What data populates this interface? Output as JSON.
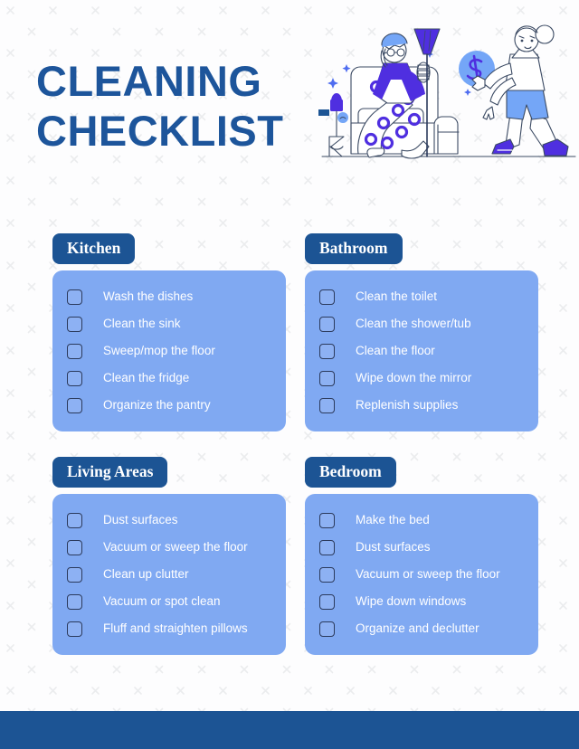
{
  "page": {
    "title_lines": [
      "CLEANING",
      "CHECKLIST"
    ],
    "title_color": "#1d559b",
    "background_color": "#fdfdfe",
    "pattern_icon": "x-mark-pattern",
    "pattern_color": "#ebecee"
  },
  "illustration": {
    "name": "cleaning-people-illustration",
    "line_color": "#3b4a63",
    "accent_purple": "#4f2fe0",
    "accent_blue": "#74a6f7",
    "elements": [
      "person-with-broom-on-armchair",
      "person-reaching-for-money-bubble",
      "armchair",
      "broom-in-stand",
      "dollar-sign-bubble",
      "sparkles"
    ]
  },
  "theme": {
    "pill_bg": "#1c5494",
    "pill_text": "#ffffff",
    "card_bg": "#80a9f2",
    "card_text": "#ffffff",
    "checkbox_border": "#2b3a5c",
    "footer_bg": "#1c5494"
  },
  "sections": [
    {
      "title": "Kitchen",
      "items": [
        "Wash the dishes",
        "Clean the sink",
        "Sweep/mop the floor",
        "Clean the fridge",
        "Organize the pantry"
      ]
    },
    {
      "title": "Bathroom",
      "items": [
        "Clean the toilet",
        "Clean the shower/tub",
        "Clean the floor",
        "Wipe down the mirror",
        "Replenish supplies"
      ]
    },
    {
      "title": "Living Areas",
      "items": [
        "Dust surfaces",
        "Vacuum or sweep the floor",
        "Clean up clutter",
        "Vacuum or spot clean",
        "Fluff and straighten pillows"
      ]
    },
    {
      "title": "Bedroom",
      "items": [
        "Make the bed",
        "Dust surfaces",
        "Vacuum or sweep the floor",
        "Wipe down windows",
        "Organize and declutter"
      ]
    }
  ]
}
